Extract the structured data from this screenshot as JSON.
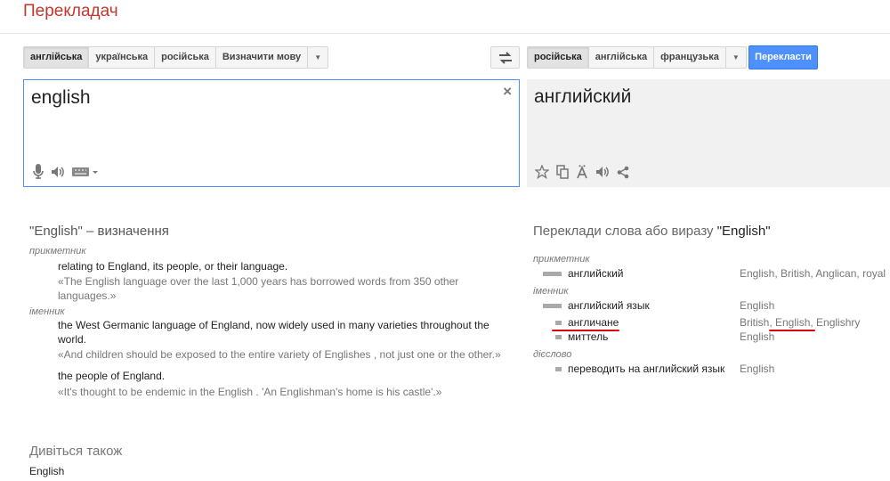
{
  "app": {
    "title": "Перекладач"
  },
  "source_langs": [
    "англійська",
    "українська",
    "російська",
    "Визначити мову"
  ],
  "target_langs": [
    "російська",
    "англійська",
    "французька"
  ],
  "translate_button": "Перекласти",
  "source_text": "english",
  "translation": "английский",
  "clear_symbol": "×",
  "definitions": {
    "heading": "\"English\" – визначення",
    "groups": [
      {
        "pos": "прикметник",
        "entries": [
          {
            "gloss": "relating to England, its people, or their language.",
            "example": "«The English language over the last 1,000 years has borrowed words from 350 other languages.»"
          }
        ]
      },
      {
        "pos": "іменник",
        "entries": [
          {
            "gloss": "the West Germanic language of England, now widely used in many varieties throughout the world.",
            "example": "«And children should be exposed to the entire variety of Englishes , not just one or the other.»"
          },
          {
            "gloss": "the people of England.",
            "example": "«It's thought to be endemic in the English . 'An Englishman's home is his castle'.»"
          }
        ]
      }
    ]
  },
  "see_also": {
    "heading": "Дивіться також",
    "value": "English"
  },
  "translations": {
    "heading_prefix": "Переклади слова або виразу ",
    "heading_term": "\"English\"",
    "groups": [
      {
        "pos": "прикметник",
        "rows": [
          {
            "word": "английский",
            "synonyms": "English, British, Anglican, royal",
            "frequency": 0.75
          }
        ]
      },
      {
        "pos": "іменник",
        "rows": [
          {
            "word": "английский язык",
            "synonyms": "English",
            "frequency": 0.75
          },
          {
            "word": "англичане",
            "synonyms": "British, English, Englishry",
            "frequency": 0.25
          },
          {
            "word": "миттель",
            "synonyms": "English",
            "frequency": 0.25
          }
        ]
      },
      {
        "pos": "дієслово",
        "rows": [
          {
            "word": "переводить на английский язык",
            "synonyms": "English",
            "frequency": 0.25
          }
        ]
      }
    ]
  },
  "colors": {
    "brand": "#c2372e",
    "accent": "#4d90fe",
    "underline": "#dd0000"
  },
  "icons": {
    "source_tools": [
      "microphone-icon",
      "speaker-icon",
      "keyboard-icon"
    ],
    "target_tools": [
      "star-icon",
      "copy-icon",
      "phonetic-icon",
      "speaker-icon",
      "share-icon"
    ]
  }
}
